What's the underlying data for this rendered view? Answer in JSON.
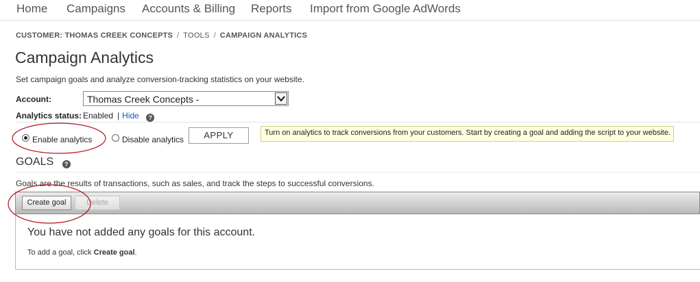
{
  "nav": {
    "items": [
      "Home",
      "Campaigns",
      "Accounts & Billing",
      "Reports",
      "Import from Google AdWords"
    ]
  },
  "breadcrumb": {
    "customer": "CUSTOMER: THOMAS CREEK CONCEPTS",
    "separator": "/",
    "tools": "TOOLS",
    "current": "CAMPAIGN ANALYTICS"
  },
  "page": {
    "title": "Campaign Analytics",
    "description": "Set campaign goals and analyze conversion-tracking statistics on your website."
  },
  "account": {
    "label": "Account:",
    "selected": "Thomas Creek Concepts -",
    "dropdown_icon": "chevron-down-icon"
  },
  "analytics_status": {
    "label": "Analytics status:",
    "value": "Enabled",
    "separator": "|",
    "hide_link": "Hide",
    "help_icon": "question-icon",
    "help_glyph": "?"
  },
  "options": {
    "enable_label": "Enable analytics",
    "disable_label": "Disable analytics",
    "selected": "enable",
    "apply_label": "APPLY"
  },
  "tooltip": {
    "text": "Turn on analytics to track conversions from your customers. Start by creating a goal and adding the script to your website."
  },
  "goals": {
    "heading": "GOALS",
    "help_glyph": "?",
    "description": "Goals are the results of transactions, such as sales, and track the steps to successful conversions.",
    "create_label": "Create goal",
    "delete_label": "Delete",
    "empty_title": "You have not added any goals for this account.",
    "empty_hint_prefix": "To add a goal, click ",
    "empty_hint_action": "Create goal",
    "empty_hint_suffix": "."
  },
  "colors": {
    "link": "#1155cc",
    "tooltip_bg": "#ffffe0",
    "annotation": "#b01020"
  }
}
